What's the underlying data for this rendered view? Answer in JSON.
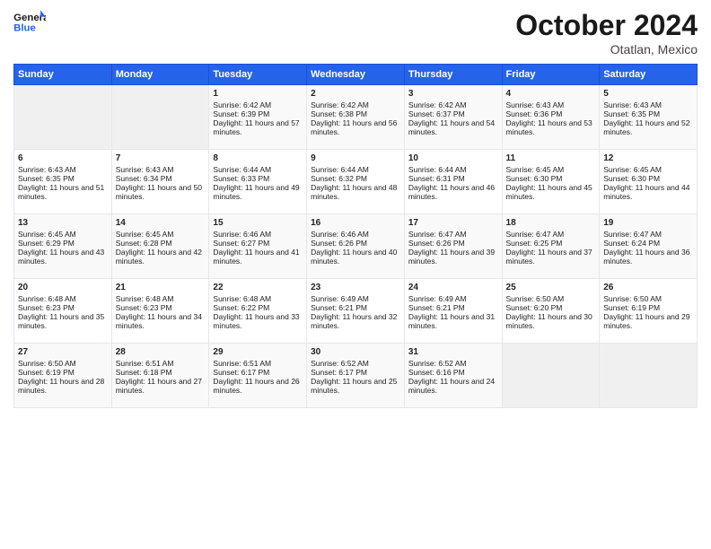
{
  "header": {
    "logo_line1": "General",
    "logo_line2": "Blue",
    "month": "October 2024",
    "location": "Otatlan, Mexico"
  },
  "days_of_week": [
    "Sunday",
    "Monday",
    "Tuesday",
    "Wednesday",
    "Thursday",
    "Friday",
    "Saturday"
  ],
  "weeks": [
    [
      {
        "day": "",
        "sunrise": "",
        "sunset": "",
        "daylight": ""
      },
      {
        "day": "",
        "sunrise": "",
        "sunset": "",
        "daylight": ""
      },
      {
        "day": "1",
        "sunrise": "Sunrise: 6:42 AM",
        "sunset": "Sunset: 6:39 PM",
        "daylight": "Daylight: 11 hours and 57 minutes."
      },
      {
        "day": "2",
        "sunrise": "Sunrise: 6:42 AM",
        "sunset": "Sunset: 6:38 PM",
        "daylight": "Daylight: 11 hours and 56 minutes."
      },
      {
        "day": "3",
        "sunrise": "Sunrise: 6:42 AM",
        "sunset": "Sunset: 6:37 PM",
        "daylight": "Daylight: 11 hours and 54 minutes."
      },
      {
        "day": "4",
        "sunrise": "Sunrise: 6:43 AM",
        "sunset": "Sunset: 6:36 PM",
        "daylight": "Daylight: 11 hours and 53 minutes."
      },
      {
        "day": "5",
        "sunrise": "Sunrise: 6:43 AM",
        "sunset": "Sunset: 6:35 PM",
        "daylight": "Daylight: 11 hours and 52 minutes."
      }
    ],
    [
      {
        "day": "6",
        "sunrise": "Sunrise: 6:43 AM",
        "sunset": "Sunset: 6:35 PM",
        "daylight": "Daylight: 11 hours and 51 minutes."
      },
      {
        "day": "7",
        "sunrise": "Sunrise: 6:43 AM",
        "sunset": "Sunset: 6:34 PM",
        "daylight": "Daylight: 11 hours and 50 minutes."
      },
      {
        "day": "8",
        "sunrise": "Sunrise: 6:44 AM",
        "sunset": "Sunset: 6:33 PM",
        "daylight": "Daylight: 11 hours and 49 minutes."
      },
      {
        "day": "9",
        "sunrise": "Sunrise: 6:44 AM",
        "sunset": "Sunset: 6:32 PM",
        "daylight": "Daylight: 11 hours and 48 minutes."
      },
      {
        "day": "10",
        "sunrise": "Sunrise: 6:44 AM",
        "sunset": "Sunset: 6:31 PM",
        "daylight": "Daylight: 11 hours and 46 minutes."
      },
      {
        "day": "11",
        "sunrise": "Sunrise: 6:45 AM",
        "sunset": "Sunset: 6:30 PM",
        "daylight": "Daylight: 11 hours and 45 minutes."
      },
      {
        "day": "12",
        "sunrise": "Sunrise: 6:45 AM",
        "sunset": "Sunset: 6:30 PM",
        "daylight": "Daylight: 11 hours and 44 minutes."
      }
    ],
    [
      {
        "day": "13",
        "sunrise": "Sunrise: 6:45 AM",
        "sunset": "Sunset: 6:29 PM",
        "daylight": "Daylight: 11 hours and 43 minutes."
      },
      {
        "day": "14",
        "sunrise": "Sunrise: 6:45 AM",
        "sunset": "Sunset: 6:28 PM",
        "daylight": "Daylight: 11 hours and 42 minutes."
      },
      {
        "day": "15",
        "sunrise": "Sunrise: 6:46 AM",
        "sunset": "Sunset: 6:27 PM",
        "daylight": "Daylight: 11 hours and 41 minutes."
      },
      {
        "day": "16",
        "sunrise": "Sunrise: 6:46 AM",
        "sunset": "Sunset: 6:26 PM",
        "daylight": "Daylight: 11 hours and 40 minutes."
      },
      {
        "day": "17",
        "sunrise": "Sunrise: 6:47 AM",
        "sunset": "Sunset: 6:26 PM",
        "daylight": "Daylight: 11 hours and 39 minutes."
      },
      {
        "day": "18",
        "sunrise": "Sunrise: 6:47 AM",
        "sunset": "Sunset: 6:25 PM",
        "daylight": "Daylight: 11 hours and 37 minutes."
      },
      {
        "day": "19",
        "sunrise": "Sunrise: 6:47 AM",
        "sunset": "Sunset: 6:24 PM",
        "daylight": "Daylight: 11 hours and 36 minutes."
      }
    ],
    [
      {
        "day": "20",
        "sunrise": "Sunrise: 6:48 AM",
        "sunset": "Sunset: 6:23 PM",
        "daylight": "Daylight: 11 hours and 35 minutes."
      },
      {
        "day": "21",
        "sunrise": "Sunrise: 6:48 AM",
        "sunset": "Sunset: 6:23 PM",
        "daylight": "Daylight: 11 hours and 34 minutes."
      },
      {
        "day": "22",
        "sunrise": "Sunrise: 6:48 AM",
        "sunset": "Sunset: 6:22 PM",
        "daylight": "Daylight: 11 hours and 33 minutes."
      },
      {
        "day": "23",
        "sunrise": "Sunrise: 6:49 AM",
        "sunset": "Sunset: 6:21 PM",
        "daylight": "Daylight: 11 hours and 32 minutes."
      },
      {
        "day": "24",
        "sunrise": "Sunrise: 6:49 AM",
        "sunset": "Sunset: 6:21 PM",
        "daylight": "Daylight: 11 hours and 31 minutes."
      },
      {
        "day": "25",
        "sunrise": "Sunrise: 6:50 AM",
        "sunset": "Sunset: 6:20 PM",
        "daylight": "Daylight: 11 hours and 30 minutes."
      },
      {
        "day": "26",
        "sunrise": "Sunrise: 6:50 AM",
        "sunset": "Sunset: 6:19 PM",
        "daylight": "Daylight: 11 hours and 29 minutes."
      }
    ],
    [
      {
        "day": "27",
        "sunrise": "Sunrise: 6:50 AM",
        "sunset": "Sunset: 6:19 PM",
        "daylight": "Daylight: 11 hours and 28 minutes."
      },
      {
        "day": "28",
        "sunrise": "Sunrise: 6:51 AM",
        "sunset": "Sunset: 6:18 PM",
        "daylight": "Daylight: 11 hours and 27 minutes."
      },
      {
        "day": "29",
        "sunrise": "Sunrise: 6:51 AM",
        "sunset": "Sunset: 6:17 PM",
        "daylight": "Daylight: 11 hours and 26 minutes."
      },
      {
        "day": "30",
        "sunrise": "Sunrise: 6:52 AM",
        "sunset": "Sunset: 6:17 PM",
        "daylight": "Daylight: 11 hours and 25 minutes."
      },
      {
        "day": "31",
        "sunrise": "Sunrise: 6:52 AM",
        "sunset": "Sunset: 6:16 PM",
        "daylight": "Daylight: 11 hours and 24 minutes."
      },
      {
        "day": "",
        "sunrise": "",
        "sunset": "",
        "daylight": ""
      },
      {
        "day": "",
        "sunrise": "",
        "sunset": "",
        "daylight": ""
      }
    ]
  ]
}
